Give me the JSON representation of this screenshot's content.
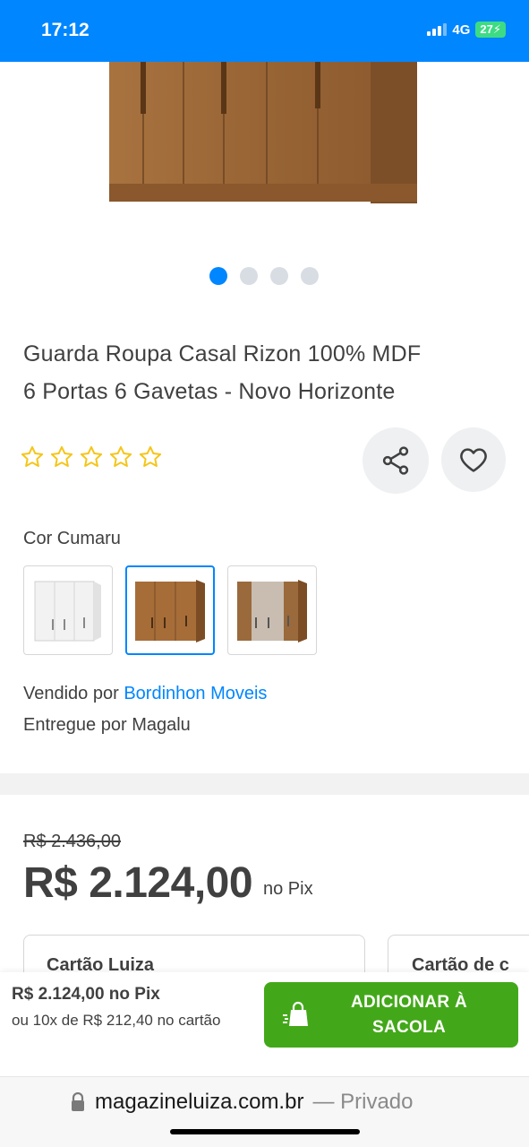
{
  "status_bar": {
    "time": "17:12",
    "network": "4G",
    "battery": "27"
  },
  "product": {
    "title_line1": "Guarda Roupa Casal Rizon 100% MDF",
    "title_line2": "6 Portas 6 Gavetas - Novo Horizonte",
    "carousel": {
      "total": 4,
      "active": 1
    },
    "rating": {
      "filled": 0,
      "max": 5
    },
    "color": {
      "label": "Cor Cumaru",
      "options": [
        {
          "name": "white"
        },
        {
          "name": "cumaru",
          "selected": true
        },
        {
          "name": "two-tone"
        }
      ]
    },
    "seller_prefix": "Vendido por",
    "seller_name": "Bordinhon Moveis",
    "delivery": "Entregue por Magalu"
  },
  "pricing": {
    "old_price": "R$ 2.436,00",
    "price": "R$ 2.124,00",
    "price_suffix": "no Pix",
    "cards": [
      {
        "title": "Cartão Luiza"
      },
      {
        "title": "Cartão de c"
      }
    ]
  },
  "bottom_bar": {
    "price_line": "R$ 2.124,00 no Pix",
    "installments": "ou 10x de R$ 212,40 no cartão",
    "add_button_line1": "ADICIONAR À",
    "add_button_line2": "SACOLA"
  },
  "browser": {
    "domain": "magazineluiza.com.br",
    "mode": "— Privado"
  },
  "colors": {
    "brand_blue": "#0086ff",
    "cta_green": "#43a819",
    "star_yellow": "#f5c518"
  }
}
